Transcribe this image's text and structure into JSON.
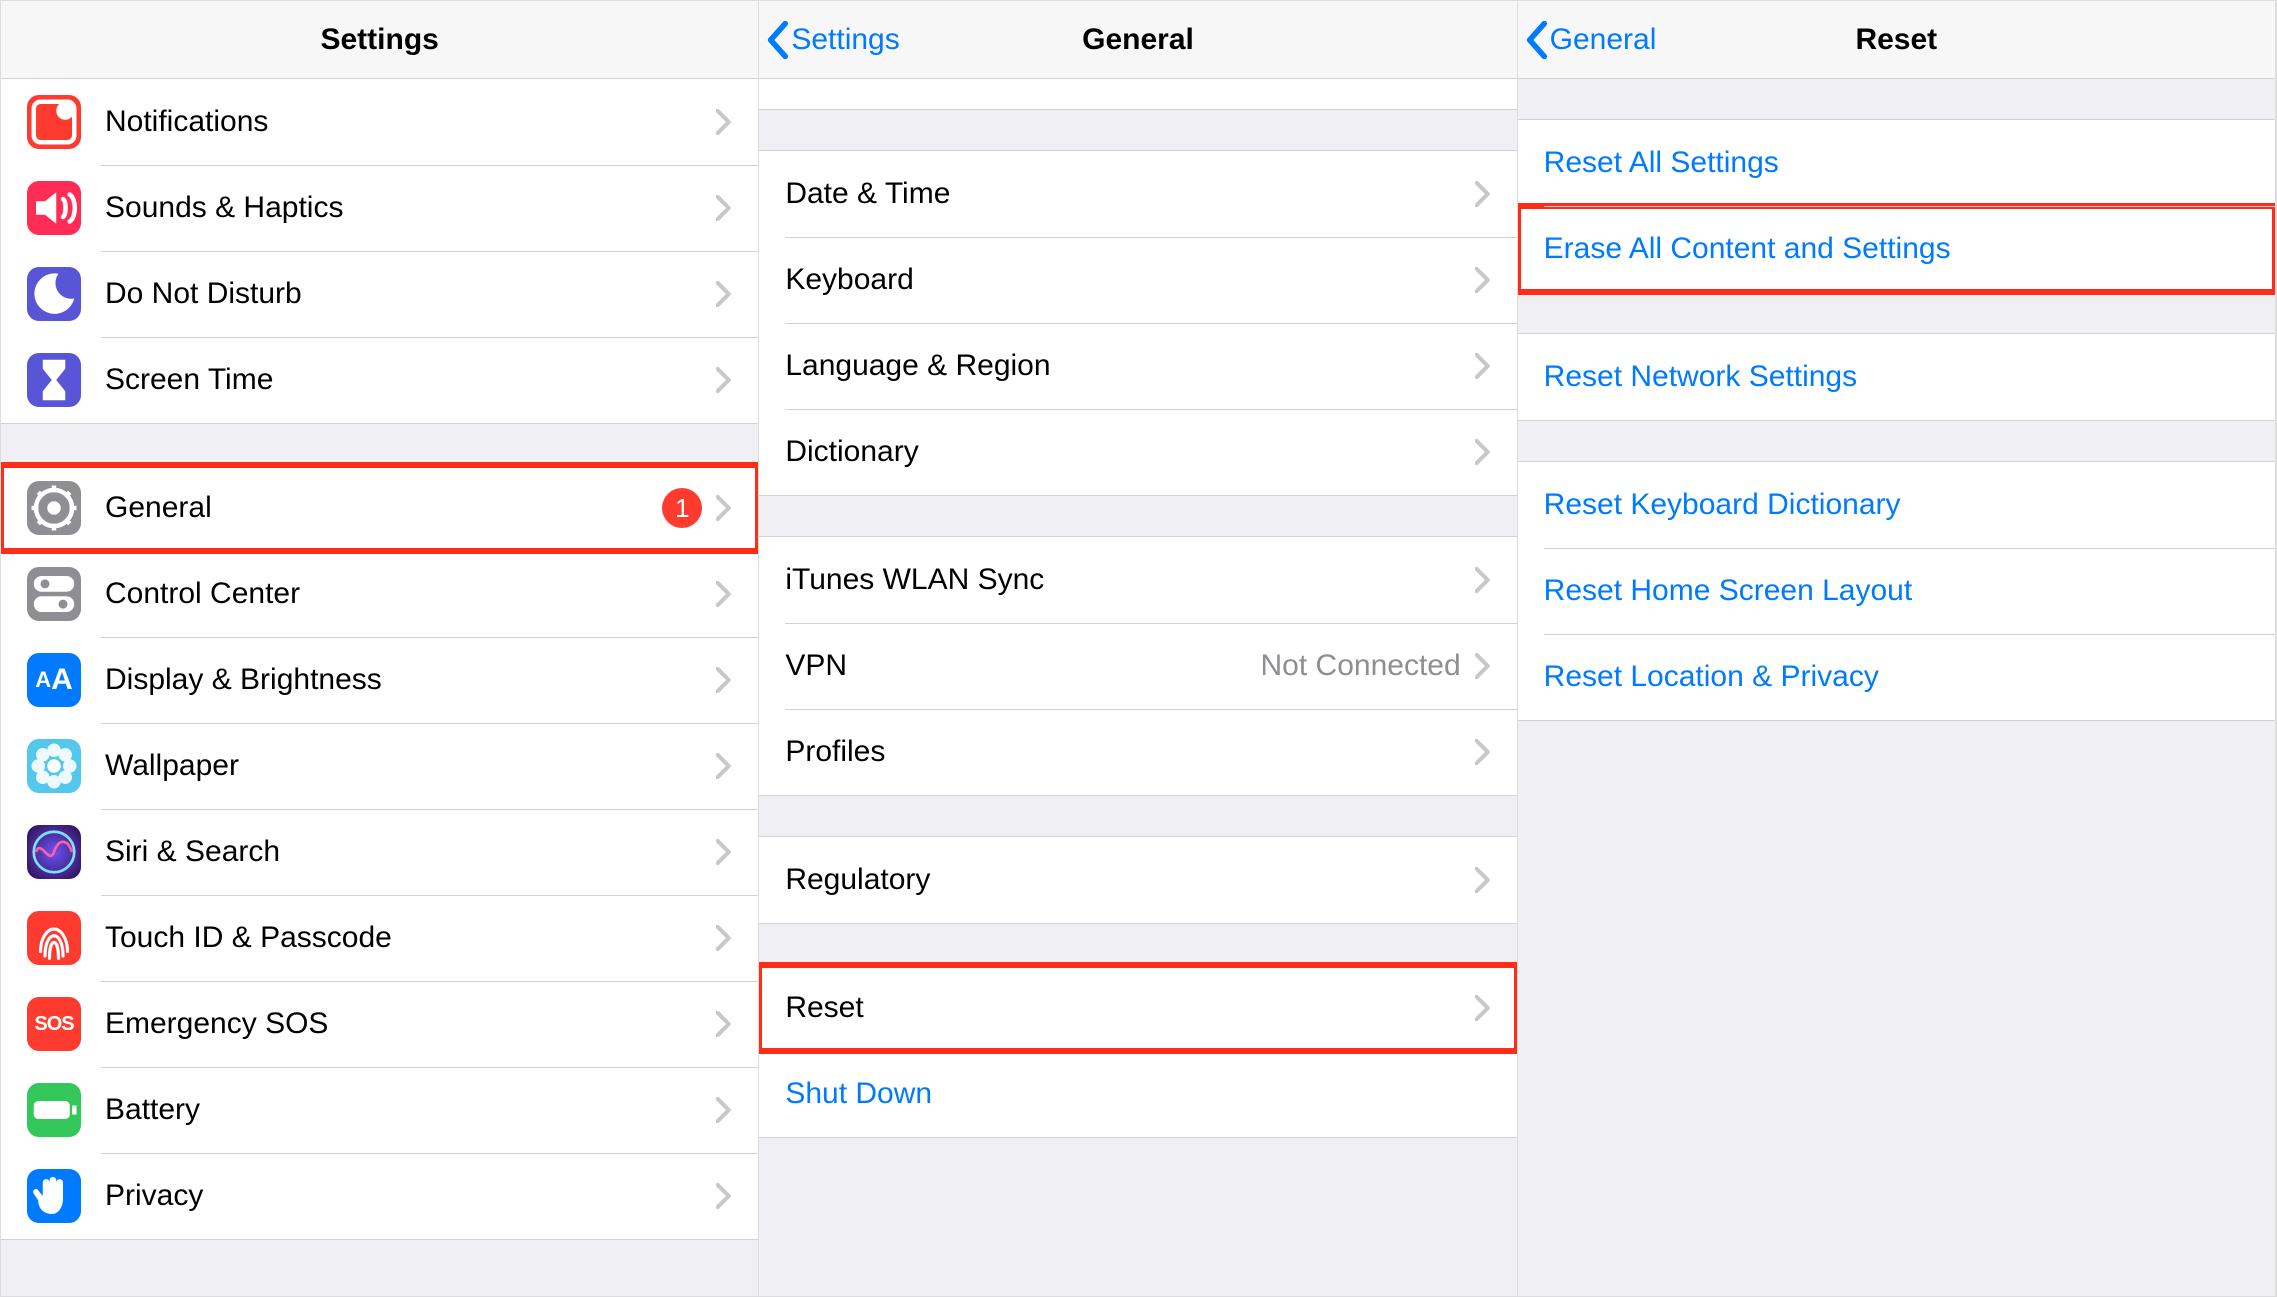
{
  "pane1": {
    "title": "Settings",
    "groups": [
      [
        {
          "id": "notifications",
          "label": "Notifications"
        },
        {
          "id": "sounds",
          "label": "Sounds & Haptics"
        },
        {
          "id": "dnd",
          "label": "Do Not Disturb"
        },
        {
          "id": "screentime",
          "label": "Screen Time"
        }
      ],
      [
        {
          "id": "general",
          "label": "General",
          "badge": "1",
          "highlight": true
        },
        {
          "id": "controlcenter",
          "label": "Control Center"
        },
        {
          "id": "display",
          "label": "Display & Brightness"
        },
        {
          "id": "wallpaper",
          "label": "Wallpaper"
        },
        {
          "id": "siri",
          "label": "Siri & Search"
        },
        {
          "id": "touchid",
          "label": "Touch ID & Passcode"
        },
        {
          "id": "sos",
          "label": "Emergency SOS"
        },
        {
          "id": "battery",
          "label": "Battery"
        },
        {
          "id": "privacy",
          "label": "Privacy"
        }
      ]
    ]
  },
  "pane2": {
    "back": "Settings",
    "title": "General",
    "sections": [
      {
        "clipped": true,
        "rows": [
          {
            "label": ""
          }
        ]
      },
      {
        "rows": [
          {
            "label": "Date & Time"
          },
          {
            "label": "Keyboard"
          },
          {
            "label": "Language & Region"
          },
          {
            "label": "Dictionary"
          }
        ]
      },
      {
        "rows": [
          {
            "label": "iTunes WLAN Sync"
          },
          {
            "label": "VPN",
            "value": "Not Connected"
          },
          {
            "label": "Profiles"
          }
        ]
      },
      {
        "rows": [
          {
            "label": "Regulatory"
          }
        ]
      },
      {
        "rows": [
          {
            "label": "Reset",
            "highlight": true
          },
          {
            "label": "Shut Down",
            "blue": true,
            "noarrow": true
          }
        ]
      }
    ]
  },
  "pane3": {
    "back": "General",
    "title": "Reset",
    "sections": [
      {
        "rows": [
          {
            "label": "Reset All Settings",
            "blue": true,
            "noarrow": true
          },
          {
            "label": "Erase All Content and Settings",
            "blue": true,
            "noarrow": true,
            "highlight": true
          }
        ]
      },
      {
        "rows": [
          {
            "label": "Reset Network Settings",
            "blue": true,
            "noarrow": true
          }
        ]
      },
      {
        "rows": [
          {
            "label": "Reset Keyboard Dictionary",
            "blue": true,
            "noarrow": true
          },
          {
            "label": "Reset Home Screen Layout",
            "blue": true,
            "noarrow": true
          },
          {
            "label": "Reset Location & Privacy",
            "blue": true,
            "noarrow": true
          }
        ]
      }
    ]
  }
}
